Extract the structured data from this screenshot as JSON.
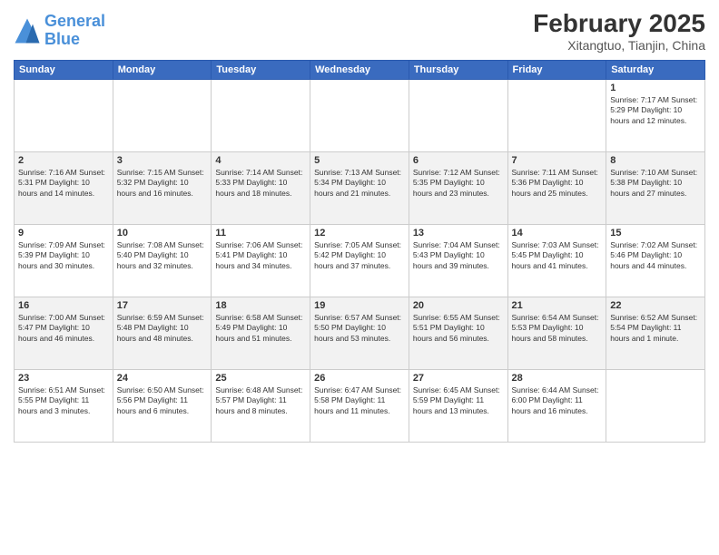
{
  "header": {
    "logo_line1": "General",
    "logo_line2": "Blue",
    "title": "February 2025",
    "subtitle": "Xitangtuo, Tianjin, China"
  },
  "days_of_week": [
    "Sunday",
    "Monday",
    "Tuesday",
    "Wednesday",
    "Thursday",
    "Friday",
    "Saturday"
  ],
  "weeks": [
    [
      {
        "day": "",
        "info": ""
      },
      {
        "day": "",
        "info": ""
      },
      {
        "day": "",
        "info": ""
      },
      {
        "day": "",
        "info": ""
      },
      {
        "day": "",
        "info": ""
      },
      {
        "day": "",
        "info": ""
      },
      {
        "day": "1",
        "info": "Sunrise: 7:17 AM\nSunset: 5:29 PM\nDaylight: 10 hours\nand 12 minutes."
      }
    ],
    [
      {
        "day": "2",
        "info": "Sunrise: 7:16 AM\nSunset: 5:31 PM\nDaylight: 10 hours\nand 14 minutes."
      },
      {
        "day": "3",
        "info": "Sunrise: 7:15 AM\nSunset: 5:32 PM\nDaylight: 10 hours\nand 16 minutes."
      },
      {
        "day": "4",
        "info": "Sunrise: 7:14 AM\nSunset: 5:33 PM\nDaylight: 10 hours\nand 18 minutes."
      },
      {
        "day": "5",
        "info": "Sunrise: 7:13 AM\nSunset: 5:34 PM\nDaylight: 10 hours\nand 21 minutes."
      },
      {
        "day": "6",
        "info": "Sunrise: 7:12 AM\nSunset: 5:35 PM\nDaylight: 10 hours\nand 23 minutes."
      },
      {
        "day": "7",
        "info": "Sunrise: 7:11 AM\nSunset: 5:36 PM\nDaylight: 10 hours\nand 25 minutes."
      },
      {
        "day": "8",
        "info": "Sunrise: 7:10 AM\nSunset: 5:38 PM\nDaylight: 10 hours\nand 27 minutes."
      }
    ],
    [
      {
        "day": "9",
        "info": "Sunrise: 7:09 AM\nSunset: 5:39 PM\nDaylight: 10 hours\nand 30 minutes."
      },
      {
        "day": "10",
        "info": "Sunrise: 7:08 AM\nSunset: 5:40 PM\nDaylight: 10 hours\nand 32 minutes."
      },
      {
        "day": "11",
        "info": "Sunrise: 7:06 AM\nSunset: 5:41 PM\nDaylight: 10 hours\nand 34 minutes."
      },
      {
        "day": "12",
        "info": "Sunrise: 7:05 AM\nSunset: 5:42 PM\nDaylight: 10 hours\nand 37 minutes."
      },
      {
        "day": "13",
        "info": "Sunrise: 7:04 AM\nSunset: 5:43 PM\nDaylight: 10 hours\nand 39 minutes."
      },
      {
        "day": "14",
        "info": "Sunrise: 7:03 AM\nSunset: 5:45 PM\nDaylight: 10 hours\nand 41 minutes."
      },
      {
        "day": "15",
        "info": "Sunrise: 7:02 AM\nSunset: 5:46 PM\nDaylight: 10 hours\nand 44 minutes."
      }
    ],
    [
      {
        "day": "16",
        "info": "Sunrise: 7:00 AM\nSunset: 5:47 PM\nDaylight: 10 hours\nand 46 minutes."
      },
      {
        "day": "17",
        "info": "Sunrise: 6:59 AM\nSunset: 5:48 PM\nDaylight: 10 hours\nand 48 minutes."
      },
      {
        "day": "18",
        "info": "Sunrise: 6:58 AM\nSunset: 5:49 PM\nDaylight: 10 hours\nand 51 minutes."
      },
      {
        "day": "19",
        "info": "Sunrise: 6:57 AM\nSunset: 5:50 PM\nDaylight: 10 hours\nand 53 minutes."
      },
      {
        "day": "20",
        "info": "Sunrise: 6:55 AM\nSunset: 5:51 PM\nDaylight: 10 hours\nand 56 minutes."
      },
      {
        "day": "21",
        "info": "Sunrise: 6:54 AM\nSunset: 5:53 PM\nDaylight: 10 hours\nand 58 minutes."
      },
      {
        "day": "22",
        "info": "Sunrise: 6:52 AM\nSunset: 5:54 PM\nDaylight: 11 hours\nand 1 minute."
      }
    ],
    [
      {
        "day": "23",
        "info": "Sunrise: 6:51 AM\nSunset: 5:55 PM\nDaylight: 11 hours\nand 3 minutes."
      },
      {
        "day": "24",
        "info": "Sunrise: 6:50 AM\nSunset: 5:56 PM\nDaylight: 11 hours\nand 6 minutes."
      },
      {
        "day": "25",
        "info": "Sunrise: 6:48 AM\nSunset: 5:57 PM\nDaylight: 11 hours\nand 8 minutes."
      },
      {
        "day": "26",
        "info": "Sunrise: 6:47 AM\nSunset: 5:58 PM\nDaylight: 11 hours\nand 11 minutes."
      },
      {
        "day": "27",
        "info": "Sunrise: 6:45 AM\nSunset: 5:59 PM\nDaylight: 11 hours\nand 13 minutes."
      },
      {
        "day": "28",
        "info": "Sunrise: 6:44 AM\nSunset: 6:00 PM\nDaylight: 11 hours\nand 16 minutes."
      },
      {
        "day": "",
        "info": ""
      }
    ]
  ]
}
